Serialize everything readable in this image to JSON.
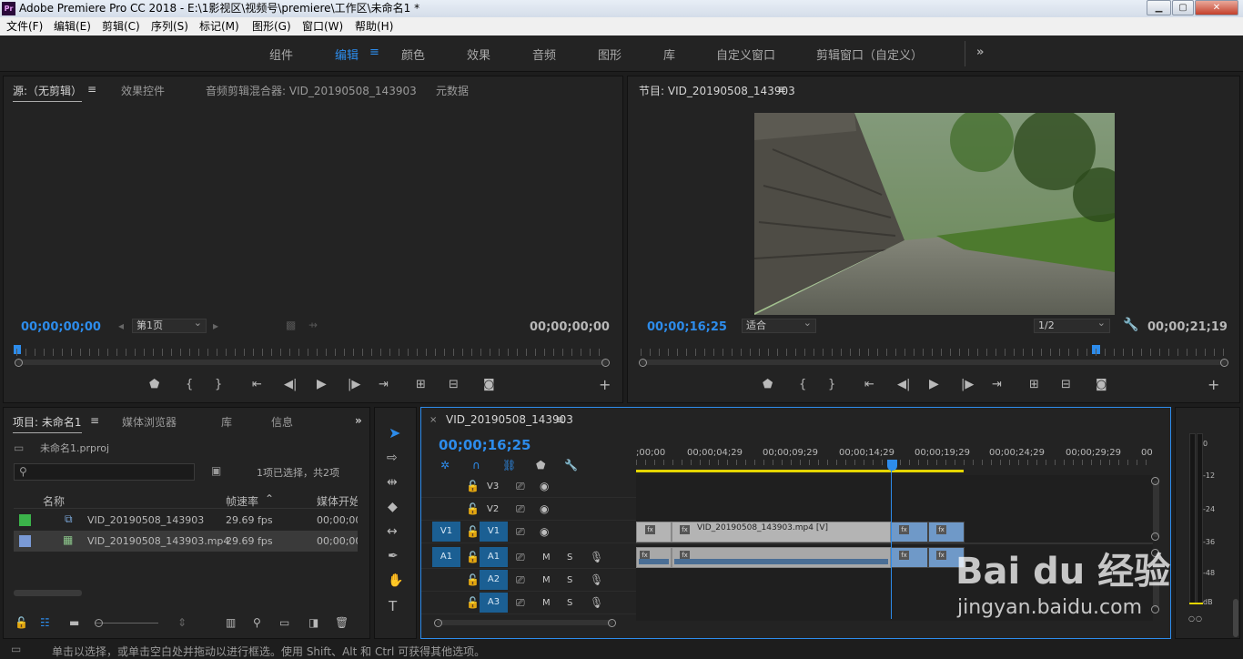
{
  "app": {
    "title": "Adobe Premiere Pro CC 2018 - E:\\1影视区\\视频号\\premiere\\工作区\\未命名1 *",
    "logo": "Pr"
  },
  "menus": [
    "文件(F)",
    "编辑(E)",
    "剪辑(C)",
    "序列(S)",
    "标记(M)",
    "图形(G)",
    "窗口(W)",
    "帮助(H)"
  ],
  "workspaces": [
    "组件",
    "编辑",
    "颜色",
    "效果",
    "音频",
    "图形",
    "库",
    "自定义窗口",
    "剪辑窗口（自定义）"
  ],
  "workspace_more": "»",
  "source": {
    "tabs": [
      "源:（无剪辑）",
      "效果控件",
      "音频剪辑混合器: VID_20190508_143903",
      "元数据"
    ],
    "tc_left": "00;00;00;00",
    "tc_right": "00;00;00;00",
    "page": "第1页"
  },
  "program": {
    "title": "节目: VID_20190508_143903",
    "tc_left": "00;00;16;25",
    "tc_right": "00;00;21;19",
    "fit": "适合",
    "res": "1/2"
  },
  "project": {
    "tabs": [
      "项目: 未命名1",
      "媒体浏览器",
      "库",
      "信息"
    ],
    "file": "未命名1.prproj",
    "selection": "1项已选择，共2项",
    "cols": [
      "名称",
      "帧速率",
      "媒体开始"
    ],
    "rows": [
      {
        "name": "VID_20190508_143903",
        "fps": "29.69 fps",
        "start": "00;00;00;",
        "color": "#3bb34a"
      },
      {
        "name": "VID_20190508_143903.mp4",
        "fps": "29.69 fps",
        "start": "00;00;00;",
        "color": "#7a9ad6"
      }
    ]
  },
  "timeline": {
    "tab": "VID_20190508_143903",
    "tc": "00;00;16;25",
    "ticks": [
      ";00;00",
      "00;00;04;29",
      "00;00;09;29",
      "00;00;14;29",
      "00;00;19;29",
      "00;00;24;29",
      "00;00;29;29",
      "00"
    ],
    "vtracks": [
      "V3",
      "V2",
      "V1"
    ],
    "atracks": [
      "A1",
      "A2",
      "A3"
    ],
    "src_v": "V1",
    "src_a": "A1",
    "clip_label": "VID_20190508_143903.mp4 [V]",
    "fx": "fx",
    "m": "M",
    "s": "S"
  },
  "meter": {
    "ticks": [
      "0",
      "-12",
      "-24",
      "-36",
      "-48",
      "dB"
    ],
    "s": "S"
  },
  "status": "单击以选择，或单击空白处并拖动以进行框选。使用 Shift、Alt 和 Ctrl 可获得其他选项。",
  "watermark": {
    "brand": "Bai du 经验",
    "url": "jingyan.baidu.com"
  }
}
